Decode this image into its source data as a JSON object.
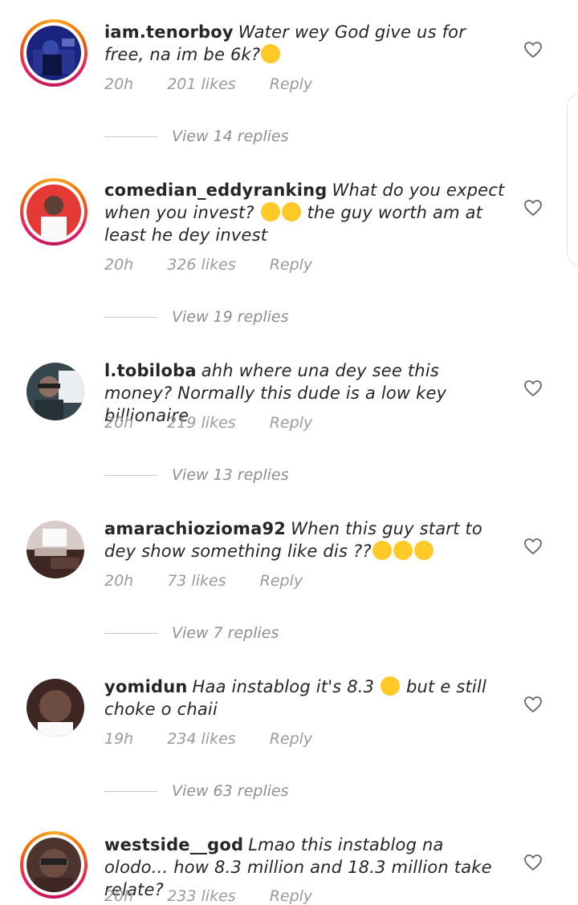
{
  "comments": [
    {
      "username": "iam.tenorboy",
      "text": "Water wey God give us for free, na im be 6k?",
      "emoji": [
        "slightly-smiling-face"
      ],
      "time": "20h",
      "likes": "201 likes",
      "reply": "Reply",
      "view_replies": "View 14 replies",
      "story_ring": true
    },
    {
      "username": "comedian_eddyranking",
      "text": "What do you expect when you invest?",
      "text_after": "the guy worth am  at least he dey invest",
      "emoji": [
        "face-with-tears-of-joy",
        "face-with-tears-of-joy"
      ],
      "time": "20h",
      "likes": "326 likes",
      "reply": "Reply",
      "view_replies": "View 19 replies",
      "story_ring": true
    },
    {
      "username": "l.tobiloba",
      "text": "ahh where una dey see this money? Normally this dude is a low key billionaire",
      "time": "20h",
      "likes": "219 likes",
      "reply": "Reply",
      "view_replies": "View 13 replies",
      "story_ring": false
    },
    {
      "username": "amarachiozioma92",
      "text": "When this guy start to dey show something like dis ??",
      "emoji": [
        "face-with-rolling-eyes",
        "face-with-rolling-eyes",
        "face-with-rolling-eyes"
      ],
      "time": "20h",
      "likes": "73 likes",
      "reply": "Reply",
      "view_replies": "View 7 replies",
      "story_ring": false
    },
    {
      "username": "yomidun",
      "text": "Haa instablog it's 8.3",
      "text_after": "but e still choke o chaii",
      "emoji": [
        "rolling-on-the-floor-laughing"
      ],
      "time": "19h",
      "likes": "234 likes",
      "reply": "Reply",
      "view_replies": "View 63 replies",
      "story_ring": false
    },
    {
      "username": "westside__god",
      "text": "Lmao this instablog na olodo... how 8.3 million and 18.3 million take relate?",
      "time": "20h",
      "likes": "233 likes",
      "reply": "Reply",
      "story_ring": true
    }
  ],
  "colors": {
    "username": "#262626",
    "meta": "#9a9a9a",
    "story_ring_start": "#f9a825",
    "story_ring_end": "#c2185b"
  },
  "icons": {
    "like": "heart-outline-icon"
  }
}
